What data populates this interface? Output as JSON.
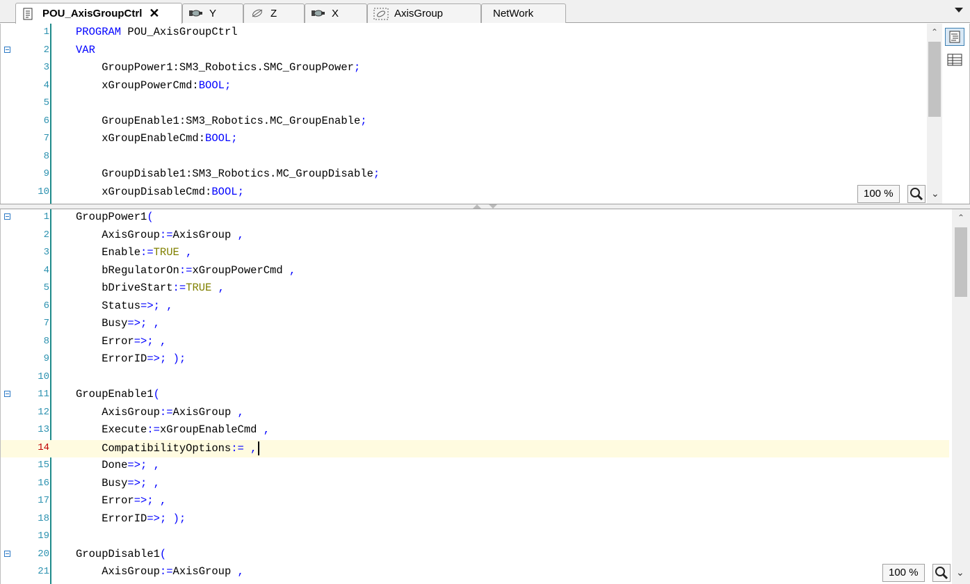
{
  "tabs": [
    {
      "label": "POU_AxisGroupCtrl",
      "icon": "pou-document-icon",
      "active": true,
      "close": "✕"
    },
    {
      "label": "Y",
      "icon": "axis-icon"
    },
    {
      "label": "Z",
      "icon": "virtual-axis-icon"
    },
    {
      "label": "X",
      "icon": "axis-icon"
    },
    {
      "label": "AxisGroup",
      "icon": "axis-group-icon"
    },
    {
      "label": "NetWork",
      "icon": ""
    }
  ],
  "decl_editor": {
    "zoom": "100 %",
    "lines": [
      {
        "num": "1",
        "text": "PROGRAM POU_AxisGroupCtrl"
      },
      {
        "num": "2",
        "text": "VAR",
        "fold": true
      },
      {
        "num": "3",
        "text": "    GroupPower1:SM3_Robotics.SMC_GroupPower;"
      },
      {
        "num": "4",
        "text": "    xGroupPowerCmd:BOOL;"
      },
      {
        "num": "5",
        "text": ""
      },
      {
        "num": "6",
        "text": "    GroupEnable1:SM3_Robotics.MC_GroupEnable;"
      },
      {
        "num": "7",
        "text": "    xGroupEnableCmd:BOOL;"
      },
      {
        "num": "8",
        "text": ""
      },
      {
        "num": "9",
        "text": "    GroupDisable1:SM3_Robotics.MC_GroupDisable;"
      },
      {
        "num": "10",
        "text": "    xGroupDisableCmd:BOOL;"
      }
    ]
  },
  "impl_editor": {
    "zoom": "100 %",
    "current_line": "14",
    "lines": [
      {
        "num": "1",
        "text": "GroupPower1(",
        "fold": true
      },
      {
        "num": "2",
        "text": "    AxisGroup:=AxisGroup ,"
      },
      {
        "num": "3",
        "text": "    Enable:=TRUE ,"
      },
      {
        "num": "4",
        "text": "    bRegulatorOn:=xGroupPowerCmd ,"
      },
      {
        "num": "5",
        "text": "    bDriveStart:=TRUE ,"
      },
      {
        "num": "6",
        "text": "    Status=> ,"
      },
      {
        "num": "7",
        "text": "    Busy=> ,"
      },
      {
        "num": "8",
        "text": "    Error=> ,"
      },
      {
        "num": "9",
        "text": "    ErrorID=> );"
      },
      {
        "num": "10",
        "text": ""
      },
      {
        "num": "11",
        "text": "GroupEnable1(",
        "fold": true
      },
      {
        "num": "12",
        "text": "    AxisGroup:=AxisGroup ,"
      },
      {
        "num": "13",
        "text": "    Execute:=xGroupEnableCmd ,"
      },
      {
        "num": "14",
        "text": "    CompatibilityOptions:= ,"
      },
      {
        "num": "15",
        "text": "    Done=> ,"
      },
      {
        "num": "16",
        "text": "    Busy=> ,"
      },
      {
        "num": "17",
        "text": "    Error=> ,"
      },
      {
        "num": "18",
        "text": "    ErrorID=> );"
      },
      {
        "num": "19",
        "text": ""
      },
      {
        "num": "20",
        "text": "GroupDisable1(",
        "fold": true
      },
      {
        "num": "21",
        "text": "    AxisGroup:=AxisGroup ,"
      }
    ]
  },
  "colors": {
    "keyword": "#0000ff",
    "literal": "#808000",
    "line_number": "#2b91af",
    "current_line_bg": "#fffbe0",
    "gutter": "#1e8a8a"
  }
}
